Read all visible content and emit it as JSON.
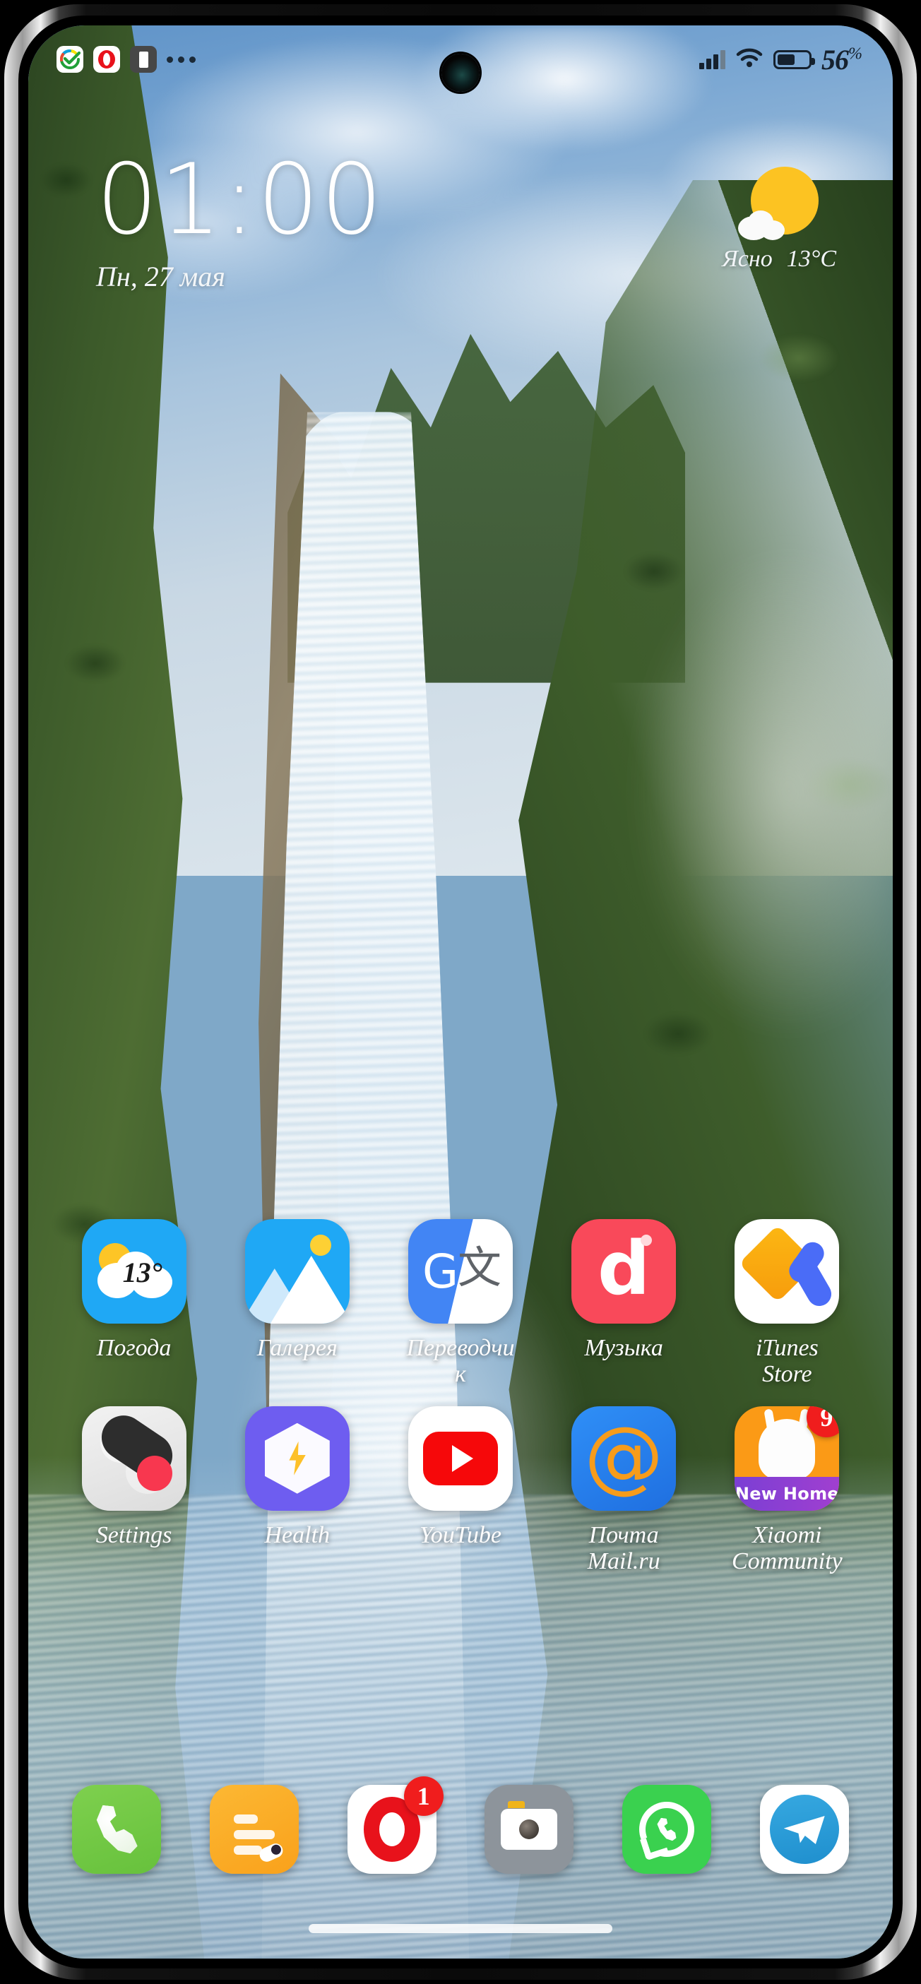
{
  "status_bar": {
    "notification_icons": [
      {
        "name": "sber-icon",
        "label": "Sber"
      },
      {
        "name": "opera-icon",
        "label": "Opera"
      },
      {
        "name": "id-card-icon",
        "label": "ID Card"
      },
      {
        "name": "more-icons",
        "label": "..."
      }
    ],
    "signal_label": "signal-bars",
    "wifi_label": "wifi",
    "battery_level": "56",
    "battery_unit": "%"
  },
  "clock_widget": {
    "time": "01:00",
    "date": "Пн, 27 мая"
  },
  "weather_widget": {
    "condition": "Ясно",
    "temperature": "13°C",
    "icon": "sun-behind-cloud-icon"
  },
  "app_grid": {
    "rows": [
      [
        {
          "name": "app-weather",
          "label": "Погода",
          "icon": "weather-icon",
          "badge_temp": "13°"
        },
        {
          "name": "app-gallery",
          "label": "Галерея",
          "icon": "gallery-icon"
        },
        {
          "name": "app-translate",
          "label": "Переводчик",
          "icon": "google-translate-icon",
          "glyph_g": "G",
          "glyph_c": "文"
        },
        {
          "name": "app-music",
          "label": "Музыка",
          "icon": "music-icon",
          "glyph": "d"
        },
        {
          "name": "app-itunes",
          "label": "iTunes Store",
          "icon": "itunes-store-icon"
        }
      ],
      [
        {
          "name": "app-settings",
          "label": "Settings",
          "icon": "settings-toggle-icon"
        },
        {
          "name": "app-health",
          "label": "Health",
          "icon": "health-hexagon-icon"
        },
        {
          "name": "app-youtube",
          "label": "YouTube",
          "icon": "youtube-icon"
        },
        {
          "name": "app-mail-ru",
          "label": "Почта Mail.ru",
          "icon": "mail-at-icon",
          "glyph": "@"
        },
        {
          "name": "app-xiaomi-community",
          "label": "Xiaomi Community",
          "icon": "xiaomi-community-icon",
          "banner": "New Home",
          "badge": "9"
        }
      ]
    ]
  },
  "dock": {
    "items": [
      {
        "name": "dock-phone",
        "icon": "phone-icon"
      },
      {
        "name": "dock-notes",
        "icon": "notes-icon"
      },
      {
        "name": "dock-opera",
        "icon": "opera-browser-icon",
        "badge": "1"
      },
      {
        "name": "dock-camera",
        "icon": "camera-icon"
      },
      {
        "name": "dock-whatsapp",
        "icon": "whatsapp-icon"
      },
      {
        "name": "dock-telegram",
        "icon": "telegram-icon"
      }
    ]
  },
  "colors": {
    "accent_blue": "#1fa8f5",
    "badge_red": "#f01d1d",
    "weather_yellow": "#fcc322",
    "whatsapp_green": "#3ad14f",
    "telegram_blue": "#2f9fd4"
  }
}
